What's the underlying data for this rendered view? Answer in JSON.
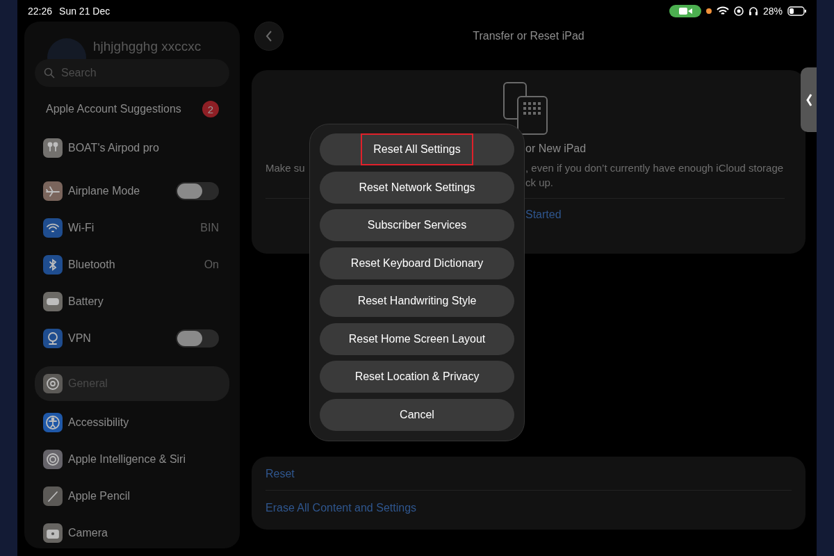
{
  "status_bar": {
    "time": "22:26",
    "date": "Sun 21 Dec",
    "battery_percent": "28%"
  },
  "sidebar": {
    "account_name": "hjhjghgghg xxccxc",
    "search": {
      "placeholder": "Search"
    },
    "suggestions": {
      "label": "Apple Account Suggestions",
      "badge": "2"
    },
    "groups": [
      {
        "items": [
          {
            "label": "BOAT's Airpod pro",
            "kind": "plain",
            "color": "#73716e",
            "selected": false
          }
        ]
      },
      {
        "items": [
          {
            "label": "Airplane Mode",
            "kind": "toggle",
            "on": false,
            "color": "#7a655c",
            "selected": false
          },
          {
            "label": "Wi-Fi",
            "kind": "value",
            "value": "BIN",
            "color": "#1f4d8f",
            "selected": false
          },
          {
            "label": "Bluetooth",
            "kind": "value",
            "value": "On",
            "color": "#1f4d8f",
            "selected": false
          },
          {
            "label": "Battery",
            "kind": "plain",
            "color": "#6c6a66",
            "selected": false
          },
          {
            "label": "VPN",
            "kind": "toggle",
            "on": false,
            "color": "#1f4d8f",
            "selected": false
          }
        ]
      },
      {
        "items": [
          {
            "label": "General",
            "kind": "plain",
            "color": "#5c5a57",
            "selected": true
          },
          {
            "label": "Accessibility",
            "kind": "plain",
            "color": "#1f58a8",
            "selected": false
          },
          {
            "label": "Apple Intelligence & Siri",
            "kind": "plain",
            "color": "#66646a",
            "selected": false
          },
          {
            "label": "Apple Pencil",
            "kind": "plain",
            "color": "#5c5a57",
            "selected": false
          },
          {
            "label": "Camera",
            "kind": "plain",
            "color": "#676562",
            "selected": false
          }
        ]
      }
    ]
  },
  "header": {
    "title": "Transfer or Reset iPad"
  },
  "prepare_card": {
    "title_visible": "or New iPad",
    "text_left": "Make su",
    "text_right": ", even if you don’t currently have enough iCloud storage",
    "text_line2": "ck up.",
    "link": "Started"
  },
  "reset_card": {
    "items": [
      "Reset",
      "Erase All Content and Settings"
    ]
  },
  "action_sheet": {
    "options": [
      {
        "label": "Reset All Settings",
        "highlighted": true
      },
      {
        "label": "Reset Network Settings",
        "highlighted": false
      },
      {
        "label": "Subscriber Services",
        "highlighted": false
      },
      {
        "label": "Reset Keyboard Dictionary",
        "highlighted": false
      },
      {
        "label": "Reset Handwriting Style",
        "highlighted": false
      },
      {
        "label": "Reset Home Screen Layout",
        "highlighted": false
      },
      {
        "label": "Reset Location & Privacy",
        "highlighted": false
      },
      {
        "label": "Cancel",
        "highlighted": false
      }
    ]
  }
}
